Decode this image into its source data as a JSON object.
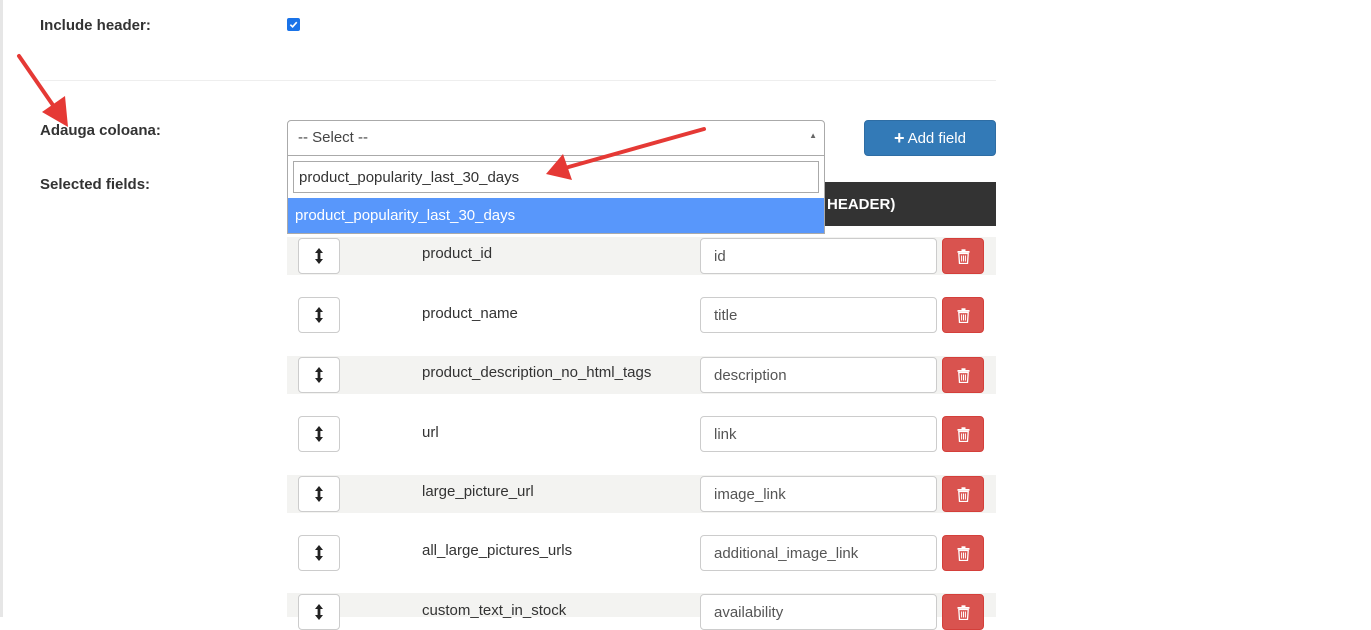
{
  "include_header": {
    "label": "Include header:",
    "checked": true
  },
  "add_column": {
    "label": "Adauga coloana:",
    "select_value": "-- Select --",
    "search_value": "product_popularity_last_30_days",
    "highlighted_option": "product_popularity_last_30_days",
    "add_button_label": "Add field"
  },
  "selected_fields": {
    "label": "Selected fields:",
    "header_column_label": "HEADER)",
    "rows": [
      {
        "field": "product_id",
        "header": "id"
      },
      {
        "field": "product_name",
        "header": "title"
      },
      {
        "field": "product_description_no_html_tags",
        "header": "description"
      },
      {
        "field": "url",
        "header": "link"
      },
      {
        "field": "large_picture_url",
        "header": "image_link"
      },
      {
        "field": "all_large_pictures_urls",
        "header": "additional_image_link"
      },
      {
        "field": "custom_text_in_stock",
        "header": "availability"
      }
    ]
  },
  "icons": {
    "drag": "vertical-arrows-icon",
    "delete": "trash-icon",
    "add": "plus-icon"
  },
  "colors": {
    "primary": "#337ab7",
    "danger": "#d9534f",
    "highlight": "#5897fb",
    "annotation": "#e53935",
    "header_bg": "#333333"
  }
}
